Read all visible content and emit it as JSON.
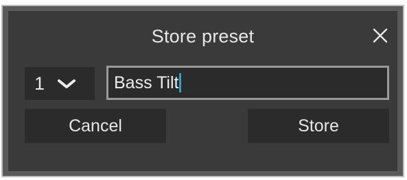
{
  "dialog": {
    "title": "Store preset",
    "close_icon": "close-icon"
  },
  "preset_select": {
    "selected": "1",
    "icon": "chevron-down-icon"
  },
  "name_input": {
    "value": "Bass Tilt"
  },
  "buttons": {
    "cancel_label": "Cancel",
    "store_label": "Store"
  },
  "colors": {
    "panel_background": "#3a3a3a",
    "control_background": "#2b2b2b",
    "caret": "#2aa3c9",
    "text": "#e8e8e8"
  }
}
